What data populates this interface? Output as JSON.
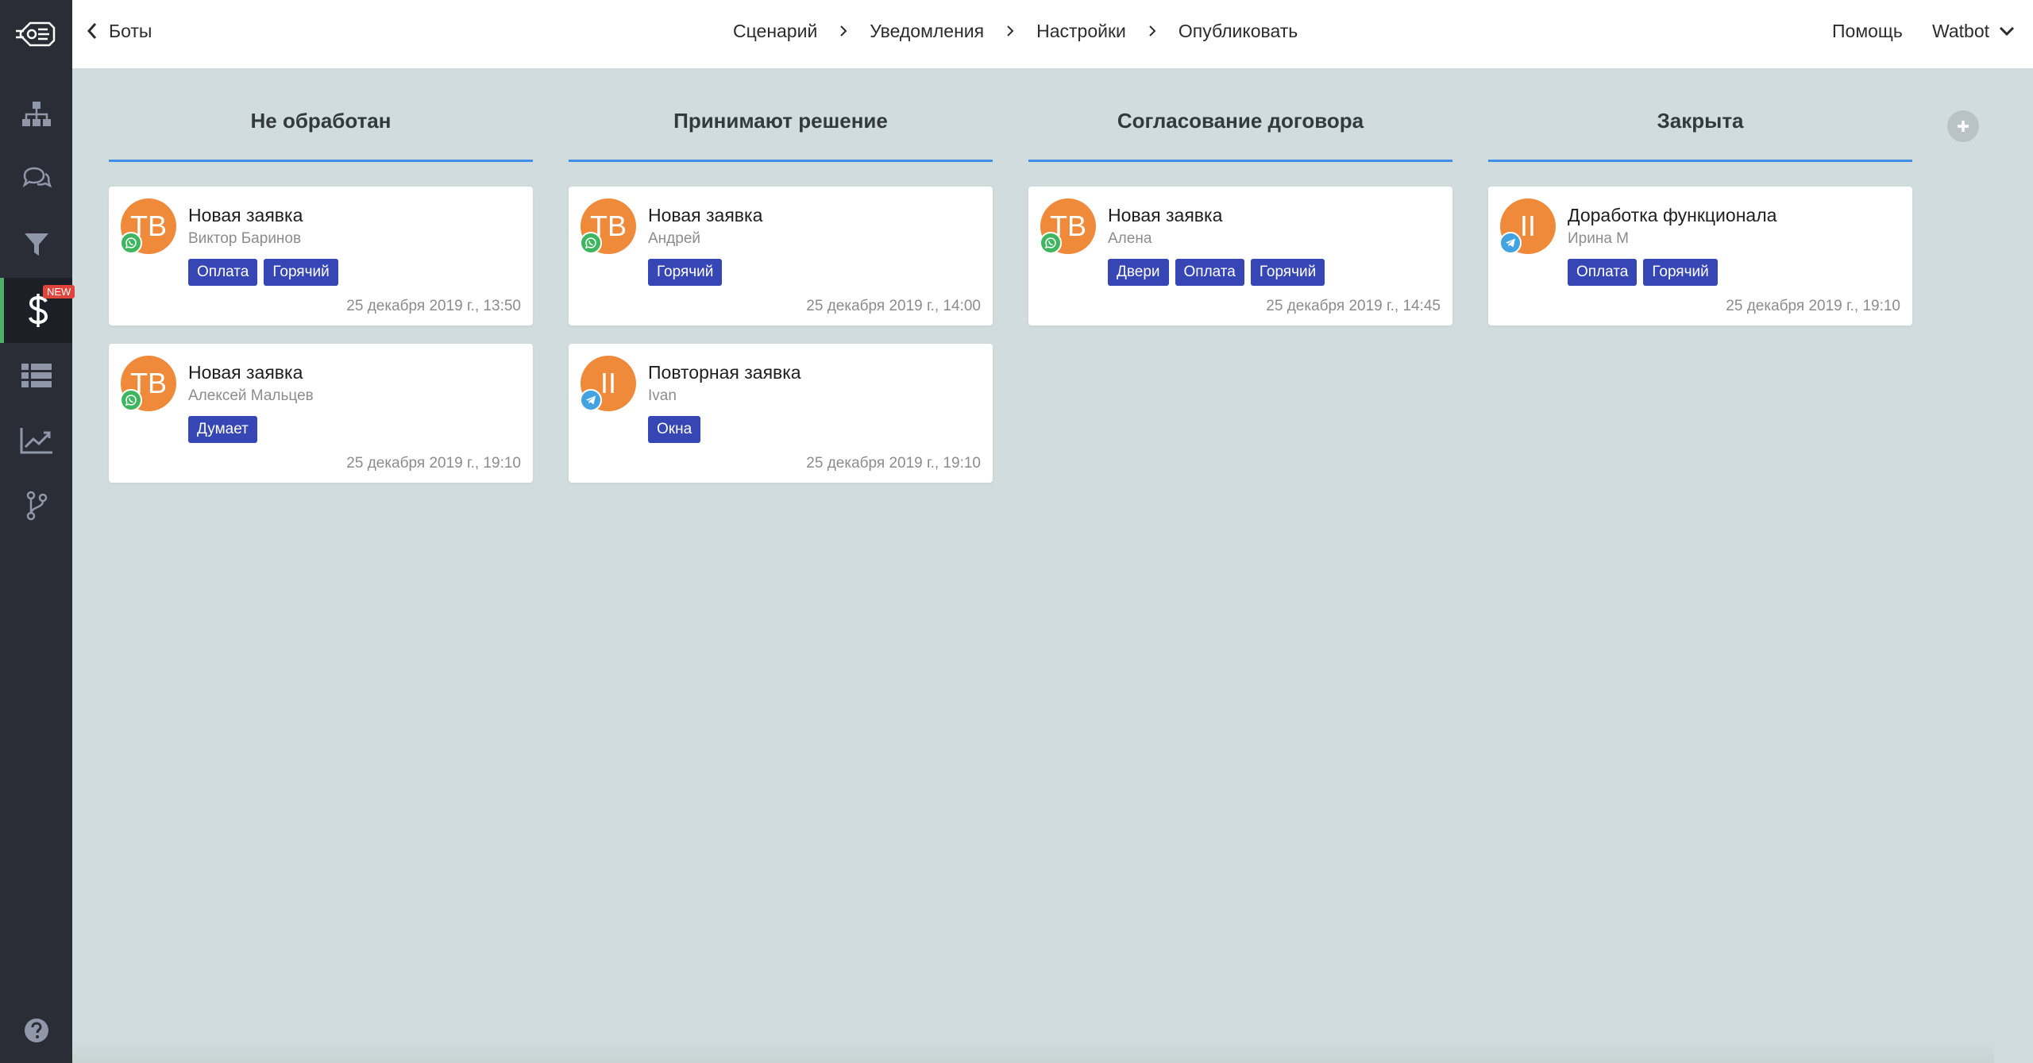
{
  "topbar": {
    "back_label": "Боты",
    "steps": [
      "Сценарий",
      "Уведомления",
      "Настройки",
      "Опубликовать"
    ],
    "help_label": "Помощь",
    "account_label": "Watbot"
  },
  "sidebar": {
    "items": [
      {
        "name": "structure-icon"
      },
      {
        "name": "chat-icon"
      },
      {
        "name": "filter-icon"
      },
      {
        "name": "dollar-icon",
        "badge": "NEW",
        "active": true
      },
      {
        "name": "list-icon"
      },
      {
        "name": "analytics-icon"
      },
      {
        "name": "branch-icon"
      }
    ],
    "help_icon": "question-icon"
  },
  "colors": {
    "accent_line": "#3f8fe6",
    "tag": "#3646b4",
    "avatar": "#ee8a3a",
    "whatsapp": "#3eb55f",
    "telegram": "#42a3e0",
    "badge_new": "#e0453d",
    "active_marker": "#4fb069"
  },
  "board": {
    "columns": [
      {
        "title": "Не обработан",
        "cards": [
          {
            "initials": "ТВ",
            "channel": "whatsapp",
            "title": "Новая заявка",
            "subtitle": "Виктор Баринов",
            "tags": [
              "Оплата",
              "Горячий"
            ],
            "time": "25 декабря 2019 г., 13:50"
          },
          {
            "initials": "ТВ",
            "channel": "whatsapp",
            "title": "Новая заявка",
            "subtitle": "Алексей Мальцев",
            "tags": [
              "Думает"
            ],
            "time": "25 декабря 2019 г., 19:10"
          }
        ]
      },
      {
        "title": "Принимают решение",
        "cards": [
          {
            "initials": "ТВ",
            "channel": "whatsapp",
            "title": "Новая заявка",
            "subtitle": "Андрей",
            "tags": [
              "Горячий"
            ],
            "time": "25 декабря 2019 г., 14:00"
          },
          {
            "initials": "II",
            "channel": "telegram",
            "title": "Повторная заявка",
            "subtitle": "Ivan",
            "tags": [
              "Окна"
            ],
            "time": "25 декабря 2019 г., 19:10"
          }
        ]
      },
      {
        "title": "Согласование договора",
        "cards": [
          {
            "initials": "ТВ",
            "channel": "whatsapp",
            "title": "Новая заявка",
            "subtitle": "Алена",
            "tags": [
              "Двери",
              "Оплата",
              "Горячий"
            ],
            "time": "25 декабря 2019 г., 14:45"
          }
        ]
      },
      {
        "title": "Закрыта",
        "cards": [
          {
            "initials": "II",
            "channel": "telegram",
            "title": "Доработка функционала",
            "subtitle": "Ирина М",
            "tags": [
              "Оплата",
              "Горячий"
            ],
            "time": "25 декабря 2019 г., 19:10"
          }
        ]
      }
    ],
    "add_column_icon": "plus-icon"
  }
}
